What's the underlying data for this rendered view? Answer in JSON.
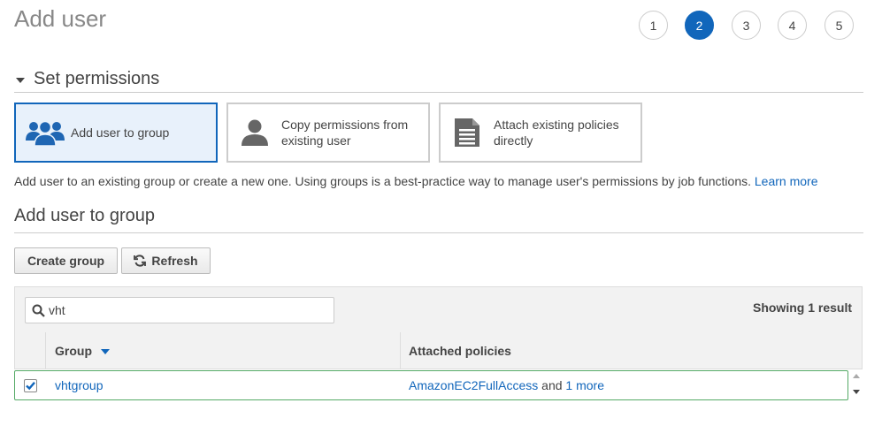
{
  "page": {
    "title": "Add user"
  },
  "steps": [
    {
      "label": "1",
      "active": false
    },
    {
      "label": "2",
      "active": true
    },
    {
      "label": "3",
      "active": false
    },
    {
      "label": "4",
      "active": false
    },
    {
      "label": "5",
      "active": false
    }
  ],
  "permissions": {
    "heading": "Set permissions",
    "options": [
      {
        "label": "Add user to group",
        "icon": "users-group-icon",
        "selected": true
      },
      {
        "label_line1": "Copy permissions from",
        "label_line2": "existing user",
        "icon": "user-icon",
        "selected": false
      },
      {
        "label_line1": "Attach existing policies",
        "label_line2": "directly",
        "icon": "document-icon",
        "selected": false
      }
    ],
    "description": "Add user to an existing group or create a new one. Using groups is a best-practice way to manage user's permissions by job functions.",
    "learn_more": "Learn more"
  },
  "group_section": {
    "heading": "Add user to group",
    "create_group_label": "Create group",
    "refresh_label": "Refresh"
  },
  "table": {
    "search_value": "vht",
    "showing": "Showing 1 result",
    "columns": {
      "group": "Group",
      "attached_policies": "Attached policies"
    },
    "rows": [
      {
        "checked": true,
        "group": "vhtgroup",
        "policy": "AmazonEC2FullAccess",
        "policy_and": "and",
        "policy_more": "1 more"
      }
    ]
  },
  "colors": {
    "accent": "#1166bb",
    "selected_bg": "#e8f1fb",
    "row_border": "#55aa66"
  }
}
